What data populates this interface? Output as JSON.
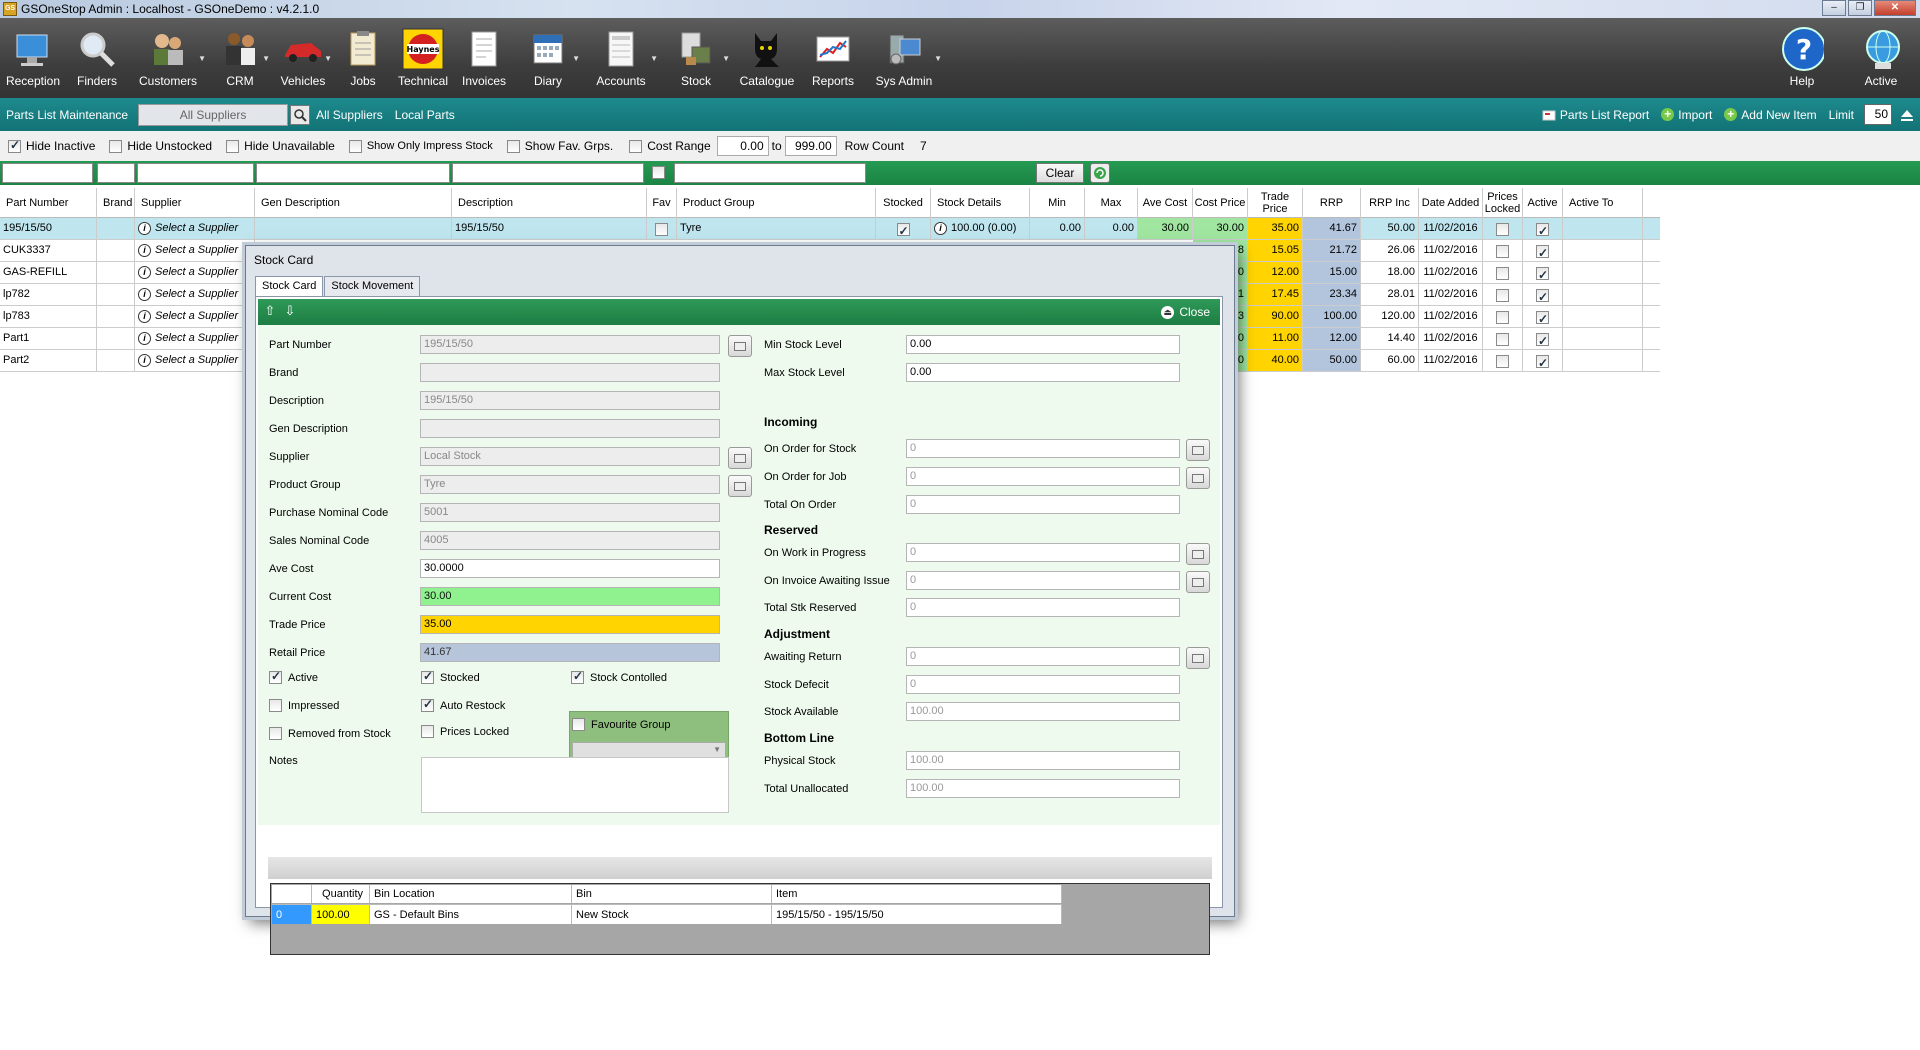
{
  "app": {
    "title": "GSOneStop Admin : Localhost - GSOneDemo : v4.2.1.0"
  },
  "toolbar": [
    {
      "id": "reception",
      "label": "Reception",
      "icon": "reception-icon",
      "dd": false
    },
    {
      "id": "finders",
      "label": "Finders",
      "icon": "magnifier-icon",
      "dd": false
    },
    {
      "id": "customers",
      "label": "Customers",
      "icon": "customers-icon",
      "dd": true
    },
    {
      "id": "crm",
      "label": "CRM",
      "icon": "crm-icon",
      "dd": true
    },
    {
      "id": "vehicles",
      "label": "Vehicles",
      "icon": "car-icon",
      "dd": true
    },
    {
      "id": "jobs",
      "label": "Jobs",
      "icon": "clipboard-icon",
      "dd": false
    },
    {
      "id": "technical",
      "label": "Technical",
      "icon": "haynes-icon",
      "dd": false
    },
    {
      "id": "invoices",
      "label": "Invoices",
      "icon": "invoice-icon",
      "dd": false
    },
    {
      "id": "diary",
      "label": "Diary",
      "icon": "calendar-icon",
      "dd": true
    },
    {
      "id": "accounts",
      "label": "Accounts",
      "icon": "ledger-icon",
      "dd": true
    },
    {
      "id": "stock",
      "label": "Stock",
      "icon": "stock-icon",
      "dd": true
    },
    {
      "id": "catalogue",
      "label": "Catalogue",
      "icon": "black-cat-icon",
      "dd": false
    },
    {
      "id": "reports",
      "label": "Reports",
      "icon": "chart-icon",
      "dd": false
    },
    {
      "id": "sysadmin",
      "label": "Sys Admin",
      "icon": "sysadmin-icon",
      "dd": true
    }
  ],
  "toolbar_right": {
    "help": "Help",
    "active": "Active"
  },
  "nav": {
    "parts_list_maintenance": "Parts List Maintenance",
    "supplier_select": "All Suppliers",
    "all_suppliers": "All Suppliers",
    "local_parts": "Local Parts",
    "parts_list_report": "Parts List Report",
    "import": "Import",
    "add_new_item": "Add New Item",
    "limit_label": "Limit",
    "limit_value": "50"
  },
  "filters": {
    "hide_inactive": "Hide Inactive",
    "hide_unstocked": "Hide Unstocked",
    "hide_unavailable": "Hide Unavailable",
    "show_only_impress": "Show Only Impress Stock",
    "show_fav_grps": "Show Fav. Grps.",
    "cost_range": "Cost Range",
    "cost_from": "0.00",
    "to": "to",
    "cost_to": "999.00",
    "row_count_label": "Row Count",
    "row_count": "7",
    "clear": "Clear"
  },
  "grid": {
    "headers": [
      "Part Number",
      "Brand",
      "Supplier",
      "Gen Description",
      "Description",
      "Fav",
      "Product Group",
      "Stocked",
      "Stock Details",
      "Min",
      "Max",
      "Ave Cost",
      "Cost Price",
      "Trade Price",
      "RRP",
      "RRP Inc",
      "Date Added",
      "Prices Locked",
      "Active",
      "Active To"
    ],
    "select_supplier": "Select a Supplier",
    "rows": [
      {
        "part": "195/15/50",
        "desc": "195/15/50",
        "group": "Tyre",
        "stock": "100.00 (0.00)",
        "min": "0.00",
        "max": "0.00",
        "ave": "30.00",
        "cost": "30.00",
        "trade": "35.00",
        "rrp": "41.67",
        "rrpinc": "50.00",
        "date": "11/02/2016",
        "stocked": true,
        "active": true
      },
      {
        "part": "CUK3337",
        "cost": "68",
        "trade": "15.05",
        "rrp": "21.72",
        "rrpinc": "26.06",
        "date": "11/02/2016",
        "active": true
      },
      {
        "part": "GAS-REFILL",
        "cost": "00",
        "trade": "12.00",
        "rrp": "15.00",
        "rrpinc": "18.00",
        "date": "11/02/2016",
        "active": true
      },
      {
        "part": "lp782",
        "cost": "71",
        "trade": "17.45",
        "rrp": "23.34",
        "rrpinc": "28.01",
        "date": "11/02/2016",
        "active": true
      },
      {
        "part": "lp783",
        "cost": "03",
        "trade": "90.00",
        "rrp": "100.00",
        "rrpinc": "120.00",
        "date": "11/02/2016",
        "active": true
      },
      {
        "part": "Part1",
        "cost": "00",
        "trade": "11.00",
        "rrp": "12.00",
        "rrpinc": "14.40",
        "date": "11/02/2016",
        "active": true
      },
      {
        "part": "Part2",
        "cost": "00",
        "trade": "40.00",
        "rrp": "50.00",
        "rrpinc": "60.00",
        "date": "11/02/2016",
        "active": true
      }
    ]
  },
  "stock_card": {
    "title": "Stock Card",
    "tabs": [
      "Stock Card",
      "Stock Movement"
    ],
    "close": "Close",
    "labels": {
      "part_number": "Part Number",
      "brand": "Brand",
      "description": "Description",
      "gen_description": "Gen Description",
      "supplier": "Supplier",
      "product_group": "Product Group",
      "purchase_nominal": "Purchase Nominal Code",
      "sales_nominal": "Sales Nominal Code",
      "ave_cost": "Ave Cost",
      "current_cost": "Current Cost",
      "trade_price": "Trade Price",
      "retail_price": "Retail Price",
      "notes": "Notes"
    },
    "values": {
      "part_number": "195/15/50",
      "brand": "",
      "description": "195/15/50",
      "gen_description": "",
      "supplier": "Local Stock",
      "product_group": "Tyre",
      "purchase_nominal": "5001",
      "sales_nominal": "4005",
      "ave_cost": "30.0000",
      "current_cost": "30.00",
      "trade_price": "35.00",
      "retail_price": "41.67"
    },
    "checks": {
      "active": "Active",
      "stocked": "Stocked",
      "stock_controlled": "Stock Contolled",
      "impressed": "Impressed",
      "auto_restock": "Auto Restock",
      "favourite_group": "Favourite Group",
      "removed_from_stock": "Removed from Stock",
      "prices_locked": "Prices Locked"
    },
    "right": {
      "min_stock_level": "Min Stock Level",
      "min_stock_value": "0.00",
      "max_stock_level": "Max Stock Level",
      "max_stock_value": "0.00",
      "incoming": "Incoming",
      "on_order_stock": "On Order for Stock",
      "on_order_stock_v": "0",
      "on_order_job": "On Order for Job",
      "on_order_job_v": "0",
      "total_on_order": "Total On Order",
      "total_on_order_v": "0",
      "reserved": "Reserved",
      "on_wip": "On Work in Progress",
      "on_wip_v": "0",
      "on_invoice": "On Invoice Awaiting Issue",
      "on_invoice_v": "0",
      "total_reserved": "Total Stk Reserved",
      "total_reserved_v": "0",
      "adjustment": "Adjustment",
      "awaiting_return": "Awaiting Return",
      "awaiting_return_v": "0",
      "stock_defecit": "Stock Defecit",
      "stock_defecit_v": "0",
      "stock_available": "Stock Available",
      "stock_available_v": "100.00",
      "bottom_line": "Bottom Line",
      "physical_stock": "Physical Stock",
      "physical_stock_v": "100.00",
      "total_unallocated": "Total Unallocated",
      "total_unallocated_v": "100.00"
    },
    "bins": {
      "headers": [
        "Quantity",
        "Bin Location",
        "Bin",
        "Item"
      ],
      "row": {
        "index": "0",
        "quantity": "100.00",
        "location": "GS - Default Bins",
        "bin": "New Stock",
        "item": "195/15/50 - 195/15/50"
      }
    }
  }
}
